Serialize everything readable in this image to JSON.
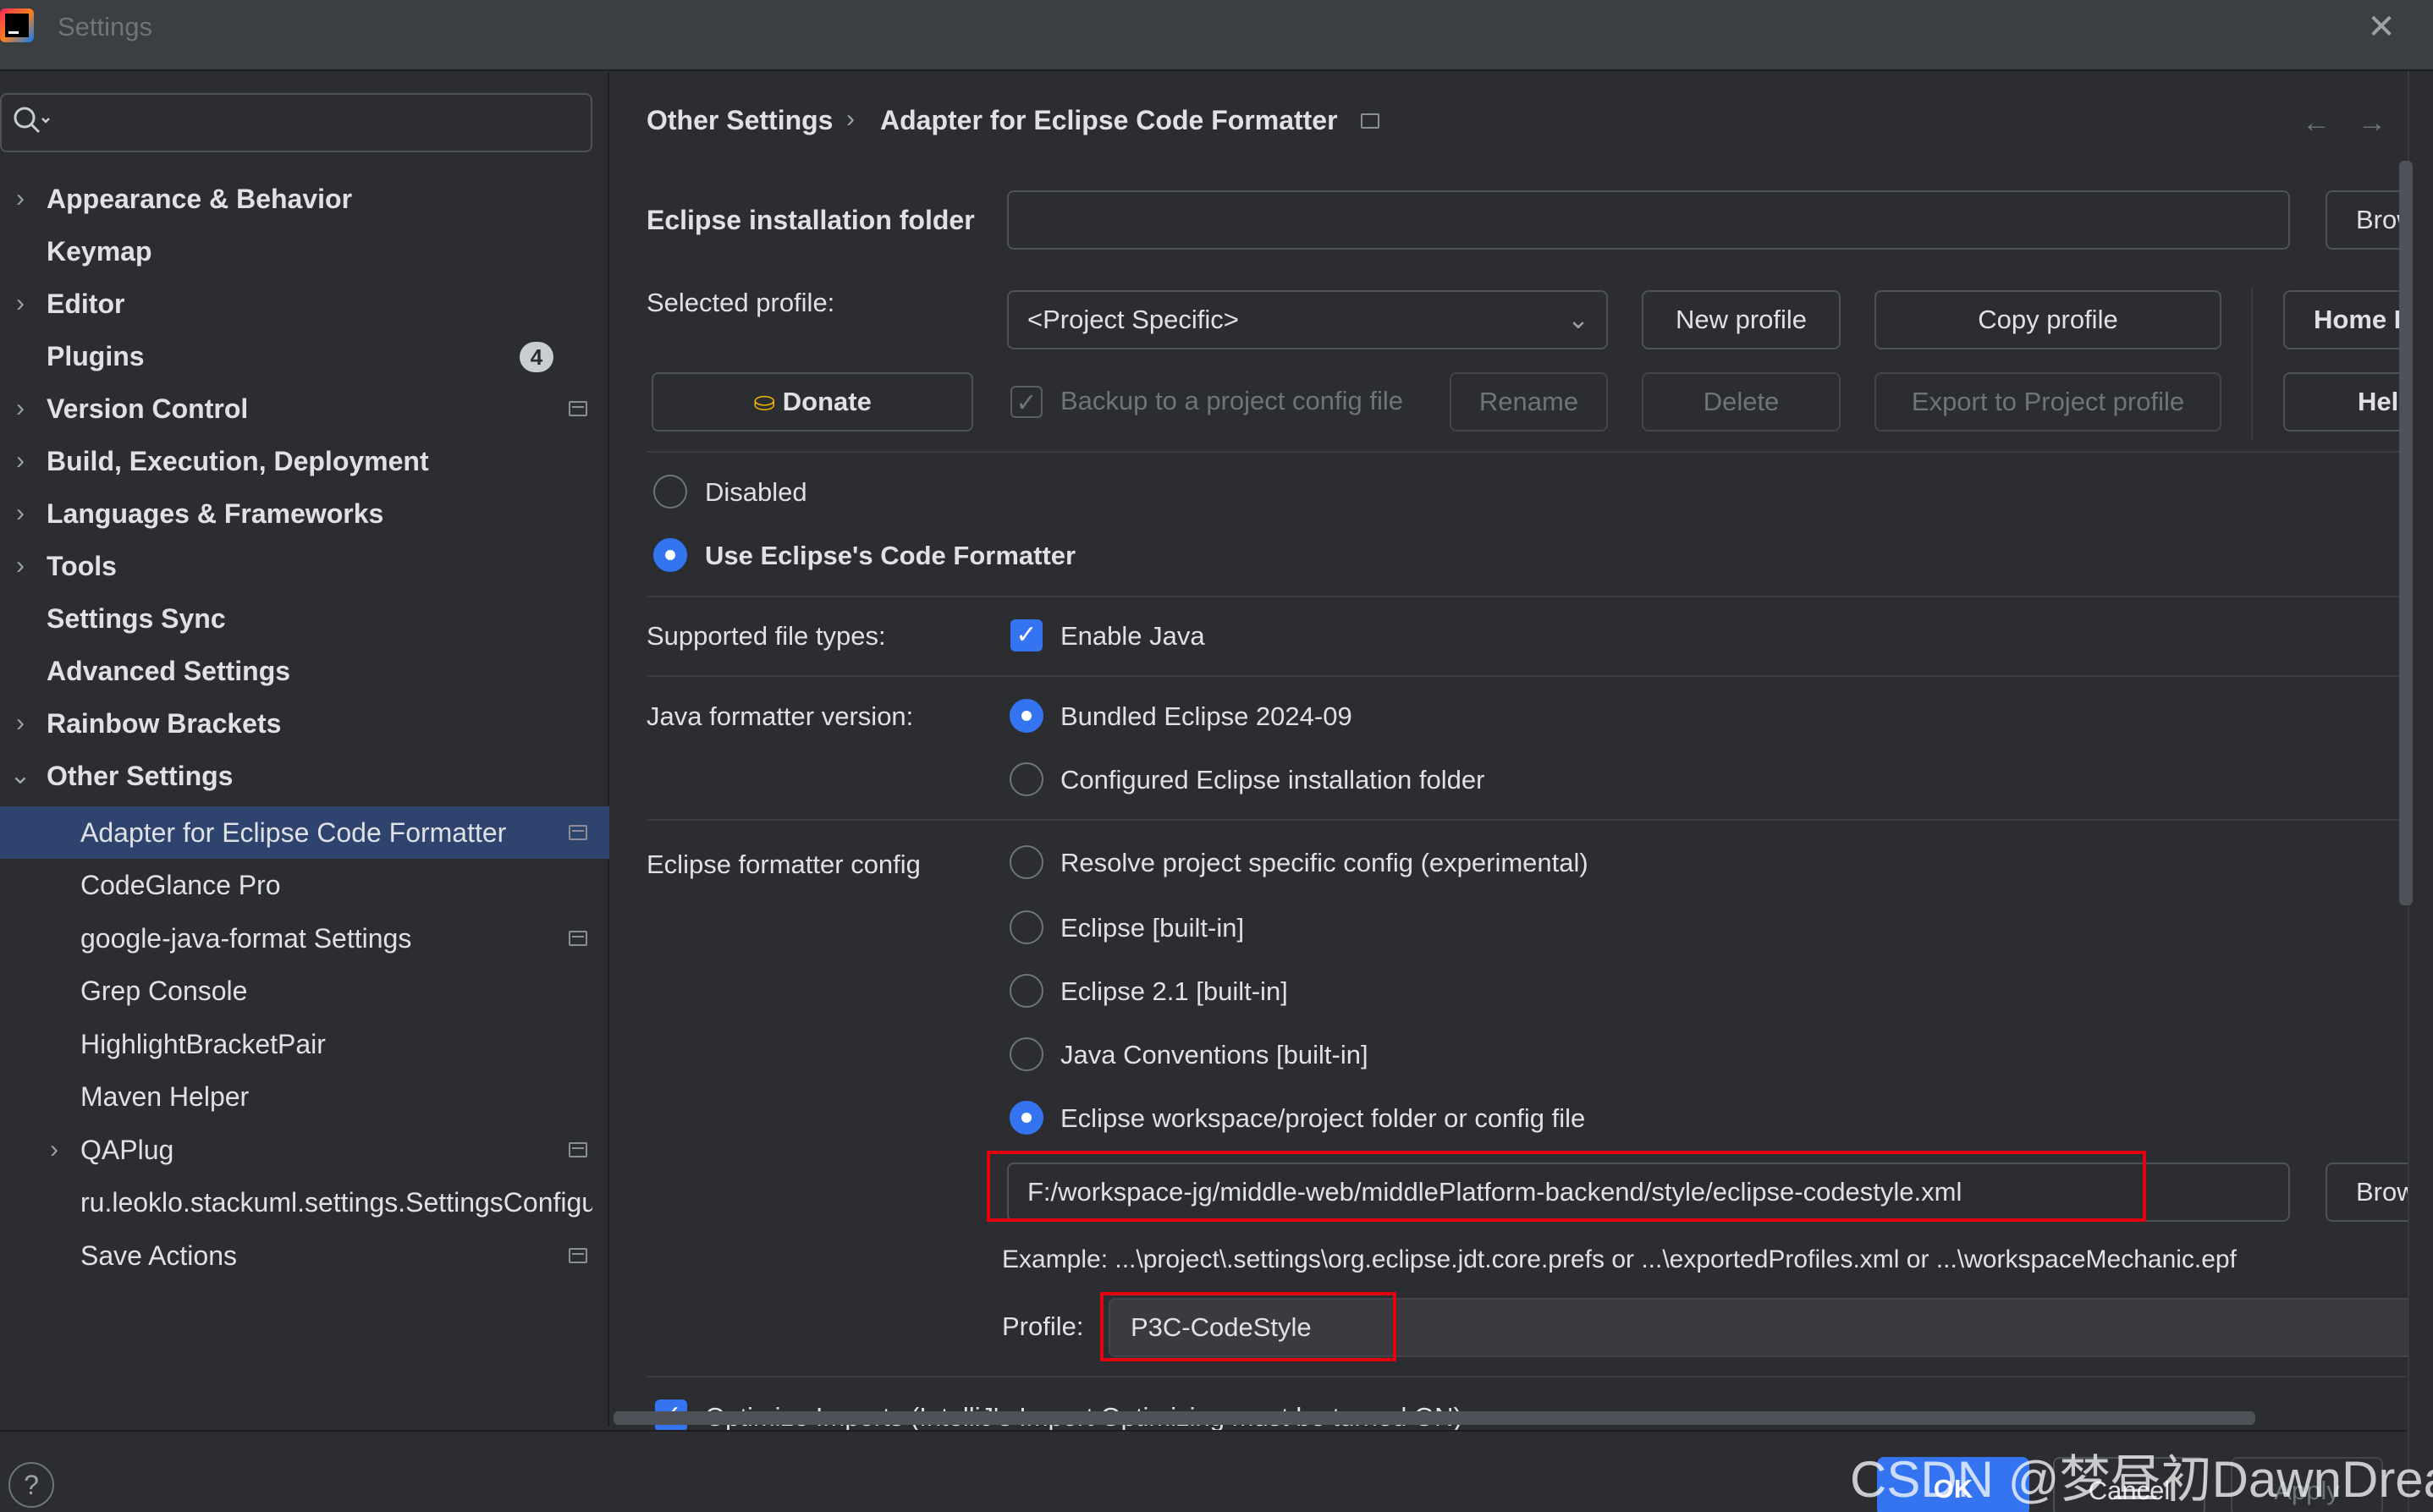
{
  "window": {
    "title": "Settings"
  },
  "search": {
    "placeholder": ""
  },
  "sidebar": {
    "items": [
      {
        "label": "Appearance & Behavior"
      },
      {
        "label": "Keymap"
      },
      {
        "label": "Editor"
      },
      {
        "label": "Plugins",
        "badge": "4"
      },
      {
        "label": "Version Control"
      },
      {
        "label": "Build, Execution, Deployment"
      },
      {
        "label": "Languages & Frameworks"
      },
      {
        "label": "Tools"
      },
      {
        "label": "Settings Sync"
      },
      {
        "label": "Advanced Settings"
      },
      {
        "label": "Rainbow Brackets"
      },
      {
        "label": "Other Settings"
      }
    ],
    "sub_items": [
      {
        "label": "Adapter for Eclipse Code Formatter"
      },
      {
        "label": "CodeGlance Pro"
      },
      {
        "label": "google-java-format Settings"
      },
      {
        "label": "Grep Console"
      },
      {
        "label": "HighlightBracketPair"
      },
      {
        "label": "Maven Helper"
      },
      {
        "label": "QAPlug"
      },
      {
        "label": "ru.leoklo.stackuml.settings.SettingsConfigu"
      },
      {
        "label": "Save Actions"
      }
    ]
  },
  "breadcrumb": {
    "parent": "Other Settings",
    "separator": "›",
    "current": "Adapter for Eclipse Code Formatter"
  },
  "nav": {
    "back": "←",
    "forward": "→"
  },
  "main": {
    "install_folder": {
      "label": "Eclipse installation folder",
      "value": "",
      "browse": "Brow"
    },
    "profile_row": {
      "label": "Selected profile:",
      "selected": "<Project Specific>",
      "new_profile": "New profile",
      "copy_profile": "Copy profile",
      "home_page": "Home P"
    },
    "second_row": {
      "donate": "Donate",
      "backup_label": "Backup to a project config file",
      "rename": "Rename",
      "delete": "Delete",
      "export": "Export to Project profile",
      "help": "Help"
    },
    "mode": {
      "disabled": "Disabled",
      "use_eclipse": "Use Eclipse's Code Formatter"
    },
    "file_types": {
      "label": "Supported file types:",
      "enable_java": "Enable Java"
    },
    "formatter_version": {
      "label": "Java formatter version:",
      "bundled": "Bundled Eclipse 2024-09",
      "configured": "Configured Eclipse installation folder"
    },
    "formatter_config": {
      "label": "Eclipse formatter config",
      "options": [
        "Resolve project specific config (experimental)",
        "Eclipse [built-in]",
        "Eclipse 2.1 [built-in]",
        "Java Conventions [built-in]",
        "Eclipse workspace/project folder or config file"
      ],
      "path_value": "F:/workspace-jg/middle-web/middlePlatform-backend/style/eclipse-codestyle.xml",
      "browse": "Brow",
      "example": "Example: ...\\project\\.settings\\org.eclipse.jdt.core.prefs or ...\\exportedProfiles.xml or ...\\workspaceMechanic.epf",
      "profile_label": "Profile:",
      "profile_value": "P3C-CodeStyle"
    },
    "optimize_imports": "Optimize Imports  (IntelliJ's Import Optimizing must be turned ON)"
  },
  "footer": {
    "ok": "OK",
    "cancel": "Cancel",
    "apply": "Apply",
    "help": "?"
  },
  "watermark": "CSDN @梦昼初DawnDream",
  "colors": {
    "accent": "#3574f0",
    "highlight": "#e3000f",
    "selected_row": "#2e436e"
  }
}
